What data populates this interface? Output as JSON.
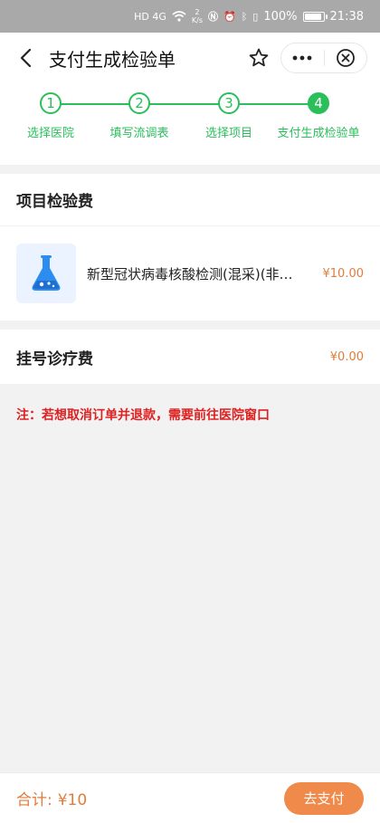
{
  "status_bar": {
    "network": "HD 4G",
    "speed_value": "2",
    "speed_unit": "K/s",
    "battery": "100%",
    "time": "21:38"
  },
  "nav": {
    "title": "支付生成检验单"
  },
  "steps": [
    {
      "num": "1",
      "label": "选择医院"
    },
    {
      "num": "2",
      "label": "填写流调表"
    },
    {
      "num": "3",
      "label": "选择项目"
    },
    {
      "num": "4",
      "label": "支付生成检验单"
    }
  ],
  "items_section": {
    "title": "项目检验费"
  },
  "item": {
    "name": "新型冠状病毒核酸检测(混采)(非…",
    "price": "¥10.00",
    "icon": "flask-icon"
  },
  "registration": {
    "title": "挂号诊疗费",
    "fee": "¥0.00"
  },
  "notice": "注：若想取消订单并退款，需要前往医院窗口",
  "footer": {
    "total_label": "合计:",
    "total_value": "¥10",
    "pay_label": "去支付"
  },
  "colors": {
    "accent_green": "#2bbf5b",
    "accent_orange": "#e07d3c",
    "pay_button": "#f08a4b",
    "notice_red": "#e02020"
  }
}
